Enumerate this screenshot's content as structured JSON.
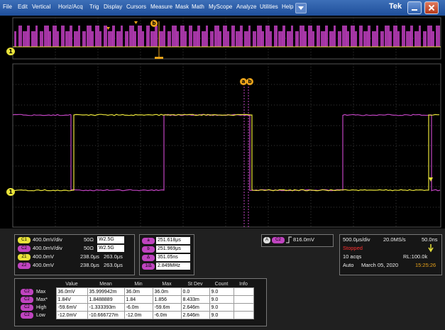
{
  "menu": {
    "items": [
      "File",
      "Edit",
      "Vertical",
      "Horiz/Acq",
      "Trig",
      "Display",
      "Cursors",
      "Measure",
      "Mask",
      "Math",
      "MyScope",
      "Analyze",
      "Utilities",
      "Help"
    ],
    "brand": "Tek"
  },
  "screen": {
    "ch1_marker": "1",
    "ch1b_marker": "1",
    "cursor_a": "a",
    "cursor_b": "b",
    "bus_marker": "b"
  },
  "channels": [
    {
      "badge": "C1",
      "color": "#e8e23a",
      "scale": "400.0mV/div",
      "impedance": "50Ω",
      "bw": "2.5G",
      "bw_icon": "W"
    },
    {
      "badge": "C2",
      "color": "#c044c0",
      "scale": "400.0mV/div",
      "impedance": "50Ω",
      "bw": "2.5G",
      "bw_icon": "W"
    },
    {
      "badge": "Z1",
      "color": "#e8e23a",
      "scale": "400.0mV",
      "time": "238.0μs",
      "time2": "263.0μs"
    },
    {
      "badge": "Z2",
      "color": "#c044c0",
      "scale": "400.0mV",
      "time": "238.0μs",
      "time2": "263.0μs"
    }
  ],
  "cursors": [
    {
      "badge": "a",
      "color": "#c044c0",
      "value": "251.618μs"
    },
    {
      "badge": "b",
      "color": "#c044c0",
      "value": "251.969μs"
    },
    {
      "badge": "Δ",
      "color": "#c044c0",
      "value": "351.05ns"
    },
    {
      "badge": "1/Δ",
      "color": "#c044c0",
      "value": "2.849MHz"
    }
  ],
  "trigger": {
    "source": "A",
    "channel": "C2",
    "value": "816.0mV"
  },
  "acquisition": {
    "timebase": "500.0μs/div",
    "sample_rate": "20.0MS/s",
    "resolution": "50.0ns",
    "state": "Stopped",
    "acqs": "10 acqs",
    "record_length": "RL:100.0k",
    "mode": "Auto",
    "date": "March 05, 2020",
    "time": "15:25:26"
  },
  "measurements": {
    "headers": [
      "Value",
      "Mean",
      "Min",
      "Max",
      "St Dev",
      "Count",
      "Info"
    ],
    "rows": [
      {
        "badge": "C2",
        "label": "Max",
        "value": "36.0mV",
        "mean": "35.999942m",
        "min": "36.0m",
        "max": "36.0m",
        "stdev": "0.0",
        "count": "9.0",
        "info": ""
      },
      {
        "badge": "C2",
        "label": "Max*",
        "value": "1.84V",
        "mean": "1.8488889",
        "min": "1.84",
        "max": "1.856",
        "stdev": "8.433m",
        "count": "9.0",
        "info": ""
      },
      {
        "badge": "C2",
        "label": "High",
        "value": "-59.6mV",
        "mean": "-1.333393m",
        "min": "-6.0m",
        "max": "-59.6m",
        "stdev": "2.646m",
        "count": "9.0",
        "info": ""
      },
      {
        "badge": "C2",
        "label": "Low",
        "value": "-12.0mV",
        "mean": "-10.666727m",
        "min": "-12.0m",
        "max": "-6.0m",
        "stdev": "2.646m",
        "count": "9.0",
        "info": ""
      }
    ]
  },
  "colors": {
    "ch1": "#e8e23a",
    "ch2": "#c044c0",
    "accent": "#e8a21a",
    "stopped": "#ff3030"
  }
}
